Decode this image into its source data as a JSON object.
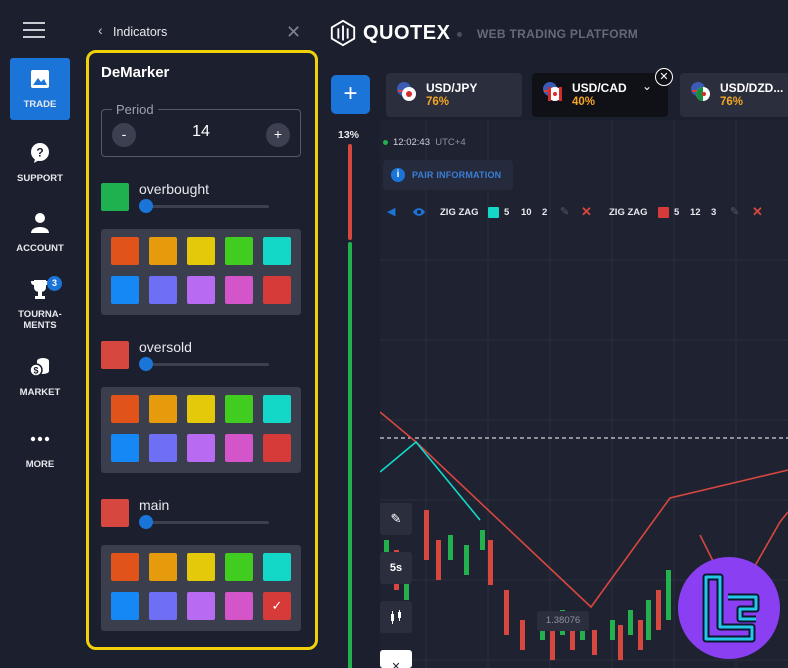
{
  "nav": {
    "items": [
      {
        "label": "TRADE",
        "icon": "chart-image-icon",
        "active": true
      },
      {
        "label": "SUPPORT",
        "icon": "question-bubble-icon"
      },
      {
        "label": "ACCOUNT",
        "icon": "user-icon"
      },
      {
        "label": "TOURNA-\nMENTS",
        "icon": "trophy-icon",
        "badge": "3"
      },
      {
        "label": "MARKET",
        "icon": "coins-icon"
      },
      {
        "label": "MORE",
        "icon": "dots-icon"
      }
    ]
  },
  "panel": {
    "header_title": "Indicators",
    "indicator_name": "DeMarker",
    "period_label": "Period",
    "period_value": "14",
    "minus": "-",
    "plus": "+",
    "lines": [
      {
        "label": "overbought",
        "color": "#1fb04f",
        "width_level": 0
      },
      {
        "label": "oversold",
        "color": "#d6473f",
        "width_level": 0
      },
      {
        "label": "main",
        "color": "#d6473f",
        "width_level": 0
      }
    ],
    "palette": [
      "#e0531b",
      "#e59b0c",
      "#e3c90a",
      "#41cd1f",
      "#13d8c8",
      "#1688f5",
      "#6e6ff4",
      "#b86af2",
      "#d355c9",
      "#d63a39"
    ],
    "checkmark": "✓"
  },
  "header": {
    "brand": "QUOTEX",
    "subtitle": "WEB TRADING PLATFORM"
  },
  "toolbar": {
    "add_label": "+",
    "percent": "13%"
  },
  "assets": [
    {
      "name": "USD/JPY",
      "pct": "76%",
      "flag": "us-jp-flag"
    },
    {
      "name": "USD/CAD",
      "pct": "40%",
      "flag": "us-ca-flag",
      "active": true
    },
    {
      "name": "USD/DZD...",
      "pct": "76%",
      "flag": "us-dz-flag"
    }
  ],
  "asset_dropdown": "⌄",
  "chart": {
    "time": "12:02:43",
    "tz": "UTC+4",
    "pair_info": "PAIR INFORMATION",
    "indicators": [
      {
        "name": "ZIG ZAG",
        "color": "#13d8c8",
        "p1": "5",
        "p2": "10",
        "p3": "2"
      },
      {
        "name": "ZIG ZAG",
        "color": "#d63a39",
        "p1": "5",
        "p2": "12",
        "p3": "3"
      }
    ],
    "timeframe": "5s",
    "price_label": "1.38076"
  }
}
